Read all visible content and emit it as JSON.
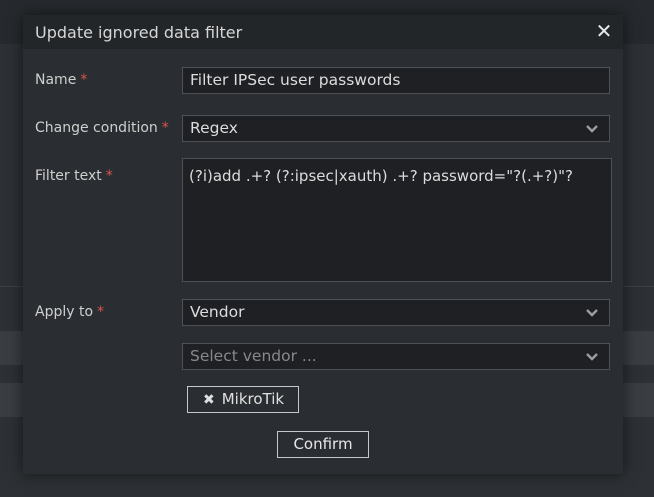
{
  "modal": {
    "title": "Update ignored data filter",
    "close_icon": "close-icon"
  },
  "fields": {
    "name": {
      "label": "Name",
      "required_mark": "*",
      "value": "Filter IPSec user passwords"
    },
    "change_condition": {
      "label": "Change condition",
      "required_mark": "*",
      "value": "Regex"
    },
    "filter_text": {
      "label": "Filter text",
      "required_mark": "*",
      "value": "(?i)add .+? (?:ipsec|xauth) .+? password=\"?(.+?)\"?"
    },
    "apply_to": {
      "label": "Apply to",
      "required_mark": "*",
      "value": "Vendor"
    },
    "vendor_select": {
      "placeholder": "Select vendor ..."
    }
  },
  "selected_vendors": [
    {
      "label": "MikroTik",
      "remove_icon": "remove-tag-icon"
    }
  ],
  "buttons": {
    "confirm": "Confirm"
  },
  "colors": {
    "required": "#d9534f",
    "modal_bg": "#2a2d31",
    "input_bg": "#1e2023"
  }
}
